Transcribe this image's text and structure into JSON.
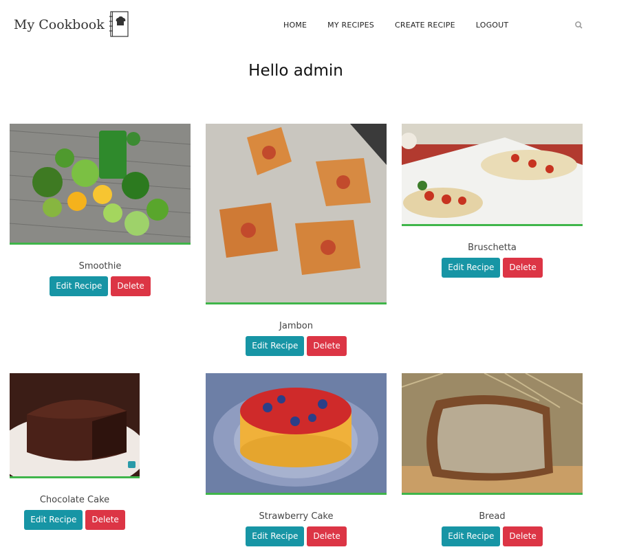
{
  "brand": {
    "name": "My Cookbook"
  },
  "nav": {
    "items": [
      "HOME",
      "MY RECIPES",
      "CREATE RECIPE",
      "LOGOUT"
    ]
  },
  "greeting": "Hello admin",
  "buttons": {
    "edit": "Edit Recipe",
    "delete": "Delete"
  },
  "recipes": [
    {
      "title": "Smoothie"
    },
    {
      "title": "Jambon"
    },
    {
      "title": "Bruschetta"
    },
    {
      "title": "Chocolate Cake"
    },
    {
      "title": "Strawberry Cake"
    },
    {
      "title": "Bread"
    }
  ],
  "colors": {
    "edit": "#1795a5",
    "delete": "#dc3545",
    "image_border": "#3fb54a"
  }
}
